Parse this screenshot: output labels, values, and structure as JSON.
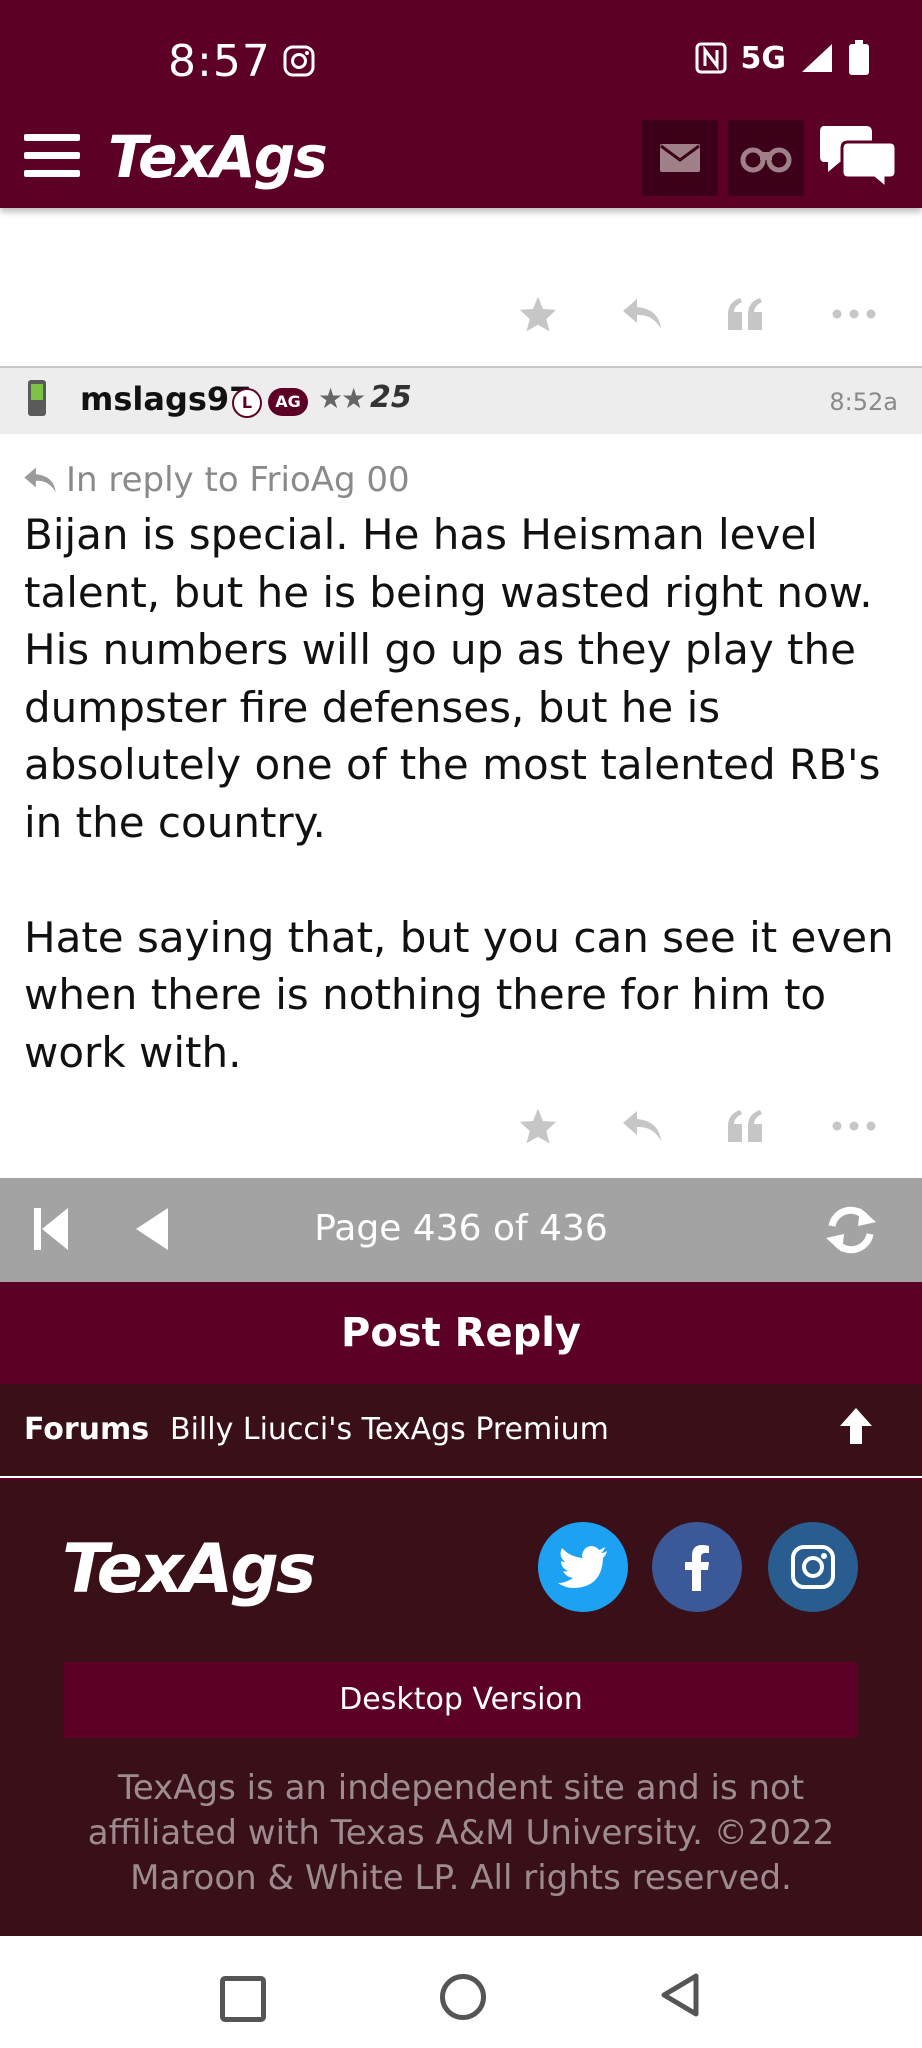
{
  "status_bar": {
    "time": "8:57",
    "network": "5G"
  },
  "header": {
    "logo": "TexAgs"
  },
  "post": {
    "username": "mslags97",
    "badge_l": "L",
    "badge_ag": "AG",
    "stars": "★★",
    "years": "25",
    "time": "8:52a",
    "reply_to": "In reply to FrioAg 00",
    "paragraphs": [
      "Bijan is special. He has Heisman level talent, but he is being wasted right now. His numbers will go up as they play the dumpster fire defenses, but he is absolutely one of the most talented RB's in the country.",
      "Hate saying that, but you can see it even when there is nothing there for him to work with."
    ]
  },
  "pager": {
    "text": "Page 436 of 436"
  },
  "post_reply": {
    "label": "Post Reply"
  },
  "breadcrumb": {
    "forums": "Forums",
    "forum_name": "Billy Liucci's TexAgs Premium"
  },
  "footer": {
    "logo": "TexAgs",
    "desktop_version": "Desktop Version",
    "disclaimer": "TexAgs is an independent site and is not affiliated with Texas A&M University. ©2022 Maroon & White LP. All rights reserved."
  },
  "colors": {
    "maroon": "#5c0025",
    "dark_maroon": "#3a1018",
    "pager_gray": "#a3a3a3"
  },
  "icons": [
    "menu-icon",
    "mail-icon",
    "binoculars-icon",
    "chat-icon",
    "star-icon",
    "reply-icon",
    "quote-icon",
    "more-icon",
    "first-page-icon",
    "prev-page-icon",
    "refresh-icon",
    "arrow-up-icon",
    "twitter-icon",
    "facebook-icon",
    "instagram-icon"
  ]
}
